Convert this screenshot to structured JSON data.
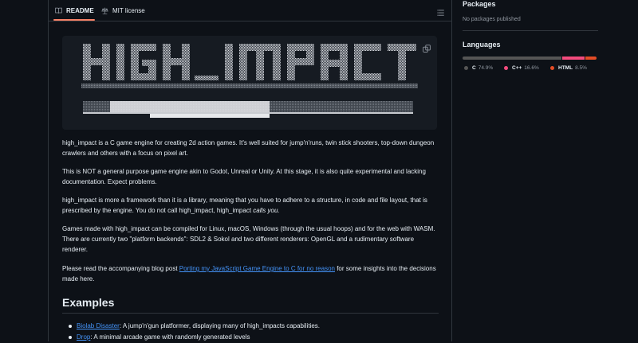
{
  "tabs": {
    "readme": "README",
    "license": "MIT license"
  },
  "banner": {
    "logo_text": "HIGH_IMPACT"
  },
  "paragraphs": {
    "p1": "high_impact is a C game engine for creating 2d action games. It's well suited for jump'n'runs, twin stick shooters, top-down dungeon crawlers and others with a focus on pixel art.",
    "p2": "This is NOT a general purpose game engine akin to Godot, Unreal or Unity. At this stage, it is also quite experimental and lacking documentation. Expect problems.",
    "p3_before": "high_impact is more a framework than it is a library, meaning that you have to adhere to a structure, in code and file layout, that is prescribed by the engine. You do not call high_impact, high_impact ",
    "p3_em": "calls you.",
    "p4": "Games made with high_impact can be compiled for Linux, macOS, Windows (through the usual hoops) and for the web with WASM. There are currently two \"platform backends\": SDL2 & Sokol and two different renderers: OpenGL and a rudimentary software renderer.",
    "p5_before": "Please read the accompanying blog post ",
    "p5_link": "Porting my JavaScript Game Engine to C for no reason",
    "p5_after": " for some insights into the decisions made here."
  },
  "examples": {
    "heading": "Examples",
    "items": [
      {
        "link": "Biolab Disaster",
        "text": ": A jump'n'gun platformer, displaying many of high_impacts capabilities."
      },
      {
        "link": "Drop",
        "text": ": A minimal arcade game with randomly generated levels"
      }
    ]
  },
  "sidebar": {
    "packages_title": "Packages",
    "packages_text": "No packages published",
    "languages_title": "Languages",
    "languages": [
      {
        "name": "C",
        "percent": "74.9%",
        "value": 74.9,
        "color": "#555555"
      },
      {
        "name": "C++",
        "percent": "16.6%",
        "value": 16.6,
        "color": "#f34b7d"
      },
      {
        "name": "HTML",
        "percent": "8.5%",
        "value": 8.5,
        "color": "#e34c26"
      }
    ]
  }
}
